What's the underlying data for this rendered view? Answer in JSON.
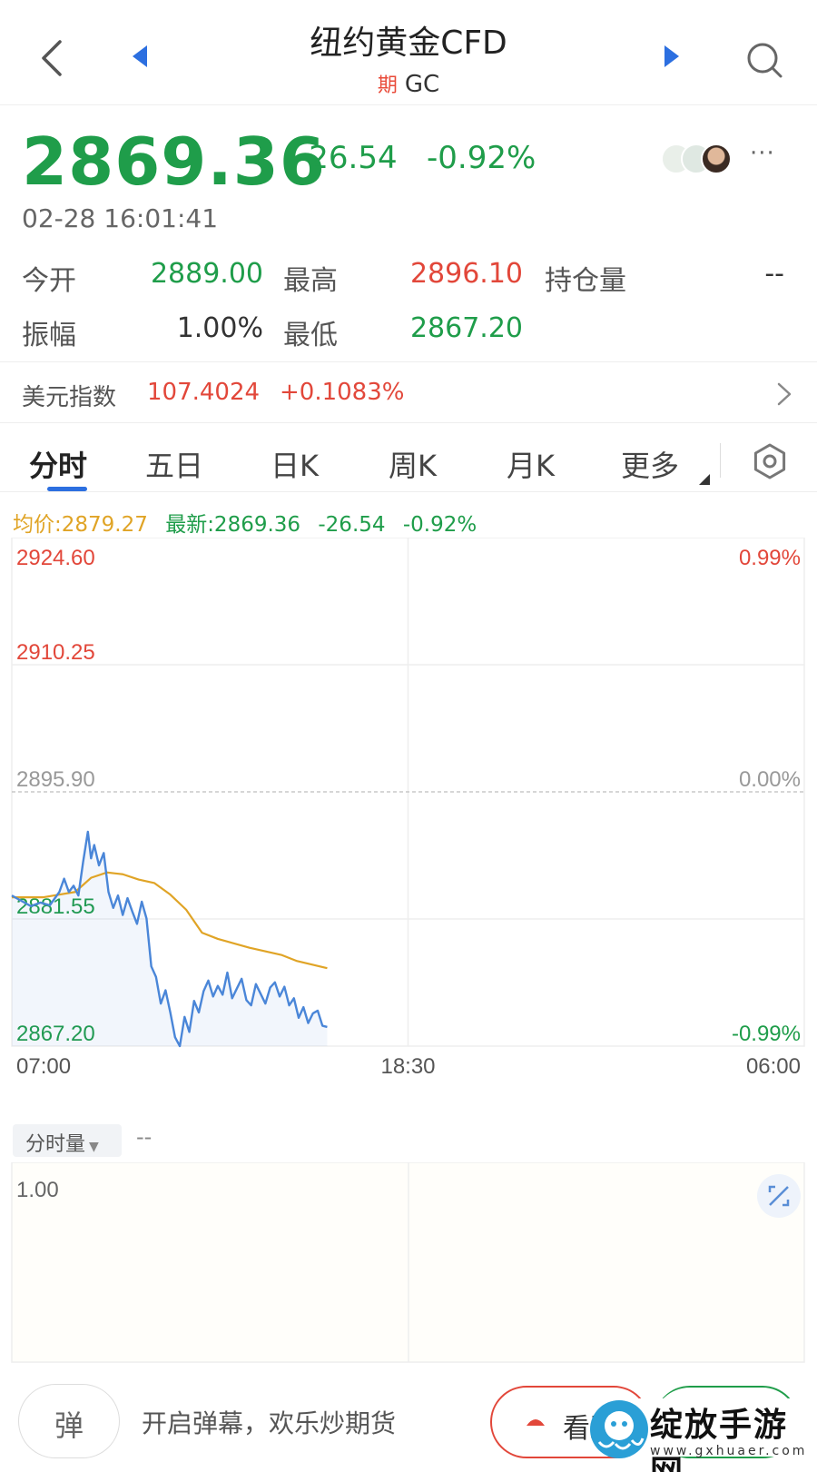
{
  "header": {
    "title": "纽约黄金CFD",
    "tag": "期",
    "code": "GC"
  },
  "quote": {
    "price": "2869.36",
    "change": "-26.54",
    "change_pct": "-0.92%",
    "time": "02-28 16:01:41",
    "more": "···"
  },
  "stats": {
    "open_label": "今开",
    "open_value": "2889.00",
    "high_label": "最高",
    "high_value": "2896.10",
    "oi_label": "持仓量",
    "oi_value": "--",
    "amp_label": "振幅",
    "amp_value": "1.00%",
    "low_label": "最低",
    "low_value": "2867.20"
  },
  "dxy": {
    "label": "美元指数",
    "value": "107.4024",
    "change_pct": "+0.1083%"
  },
  "tabs": [
    "分时",
    "五日",
    "日K",
    "周K",
    "月K",
    "更多"
  ],
  "legend": {
    "avg": "均价:2879.27",
    "latest": "最新:2869.36",
    "change": "-26.54",
    "change_pct": "-0.92%"
  },
  "chart_data": {
    "type": "line",
    "y_ticks": [
      "2924.60",
      "2910.25",
      "2895.90",
      "2881.55",
      "2867.20"
    ],
    "pct_ticks": [
      "0.99%",
      "0.00%",
      "-0.99%"
    ],
    "x_ticks": [
      "07:00",
      "18:30",
      "06:00"
    ],
    "ylim": [
      2867.2,
      2924.6
    ],
    "baseline": 2895.9,
    "series": [
      {
        "color": "#4a86d8",
        "x": [
          0,
          0.012,
          0.024,
          0.036,
          0.048,
          0.06,
          0.066,
          0.072,
          0.078,
          0.084,
          0.09,
          0.096,
          0.1,
          0.104,
          0.11,
          0.116,
          0.122,
          0.128,
          0.134,
          0.14,
          0.146,
          0.152,
          0.158,
          0.164,
          0.17,
          0.176,
          0.182,
          0.188,
          0.194,
          0.2,
          0.206,
          0.212,
          0.218,
          0.224,
          0.23,
          0.236,
          0.242,
          0.248,
          0.254,
          0.26,
          0.266,
          0.272,
          0.278,
          0.284,
          0.29,
          0.296,
          0.302,
          0.308,
          0.314,
          0.32,
          0.326,
          0.332,
          0.338,
          0.344,
          0.35,
          0.356,
          0.362,
          0.368,
          0.374,
          0.38,
          0.386,
          0.392,
          0.398
        ],
        "y": [
          2884.2,
          2883.6,
          2883.0,
          2883.4,
          2883.1,
          2884.6,
          2886.1,
          2884.6,
          2885.3,
          2884.2,
          2888.0,
          2891.4,
          2888.4,
          2889.9,
          2887.6,
          2889.0,
          2884.6,
          2882.8,
          2884.2,
          2882.0,
          2883.9,
          2882.4,
          2881.0,
          2883.5,
          2881.6,
          2876.2,
          2875.0,
          2872.0,
          2873.5,
          2871.0,
          2868.2,
          2867.2,
          2870.5,
          2868.8,
          2872.3,
          2871.0,
          2873.4,
          2874.6,
          2872.8,
          2874.0,
          2873.0,
          2875.5,
          2872.6,
          2873.7,
          2874.8,
          2872.4,
          2871.8,
          2874.2,
          2873.1,
          2872.0,
          2873.8,
          2874.4,
          2872.8,
          2873.9,
          2871.8,
          2872.6,
          2870.4,
          2871.6,
          2869.8,
          2870.9,
          2871.2,
          2869.5,
          2869.36
        ]
      },
      {
        "color": "#e0a426",
        "x": [
          0,
          0.04,
          0.08,
          0.1,
          0.12,
          0.14,
          0.16,
          0.18,
          0.2,
          0.22,
          0.24,
          0.26,
          0.3,
          0.34,
          0.36,
          0.398
        ],
        "y": [
          2884.0,
          2884.0,
          2884.6,
          2886.2,
          2886.8,
          2886.6,
          2886.0,
          2885.6,
          2884.3,
          2882.6,
          2880.0,
          2879.3,
          2878.3,
          2877.5,
          2876.8,
          2876.0
        ]
      }
    ]
  },
  "volume": {
    "label": "分时量",
    "value": "--",
    "y_tick": "1.00"
  },
  "bottom": {
    "danmu_icon": "弹",
    "danmu_prompt": "开启弹幕，欢乐炒期货",
    "bear_label": "看跌",
    "watermark": "绽放手游网",
    "watermark_url": "www.gxhuaer.com"
  },
  "colors": {
    "up": "#e2473a",
    "down": "#1f9d4a",
    "price_line": "#4a86d8",
    "avg_line": "#e0a426"
  }
}
